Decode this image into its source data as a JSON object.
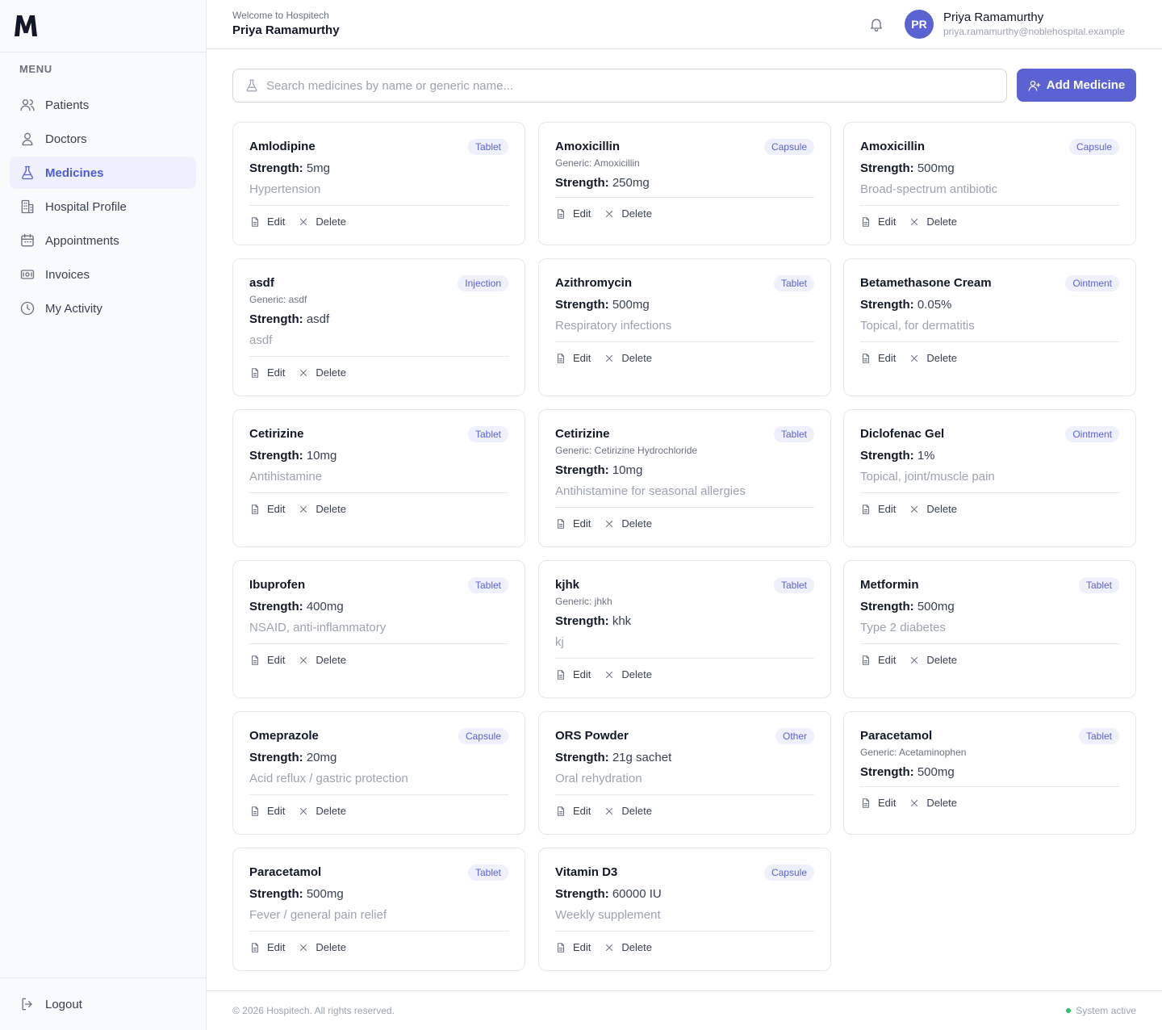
{
  "app": {
    "logo_letter": "M"
  },
  "sidebar": {
    "menu_title": "MENU",
    "items": [
      {
        "label": "Patients",
        "icon": "users-icon",
        "active": false
      },
      {
        "label": "Doctors",
        "icon": "user-icon",
        "active": false
      },
      {
        "label": "Medicines",
        "icon": "flask-icon",
        "active": true
      },
      {
        "label": "Hospital Profile",
        "icon": "building-icon",
        "active": false
      },
      {
        "label": "Appointments",
        "icon": "calendar-icon",
        "active": false
      },
      {
        "label": "Invoices",
        "icon": "banknote-icon",
        "active": false
      },
      {
        "label": "My Activity",
        "icon": "clock-icon",
        "active": false
      }
    ],
    "logout_label": "Logout"
  },
  "header": {
    "welcome": "Welcome to Hospitech",
    "name": "Priya Ramamurthy",
    "avatar_initials": "PR",
    "user_name": "Priya Ramamurthy",
    "user_email": "priya.ramamurthy@noblehospital.example"
  },
  "search": {
    "placeholder": "Search medicines by name or generic name...",
    "value": ""
  },
  "add_button": {
    "label": "Add Medicine"
  },
  "card_labels": {
    "strength": "Strength:",
    "edit": "Edit",
    "delete": "Delete"
  },
  "medicines": [
    {
      "name": "Amlodipine",
      "type": "Tablet",
      "generic": "",
      "strength": "5mg",
      "description": "Hypertension"
    },
    {
      "name": "Amoxicillin",
      "type": "Capsule",
      "generic": "Generic: Amoxicillin",
      "strength": "250mg",
      "description": ""
    },
    {
      "name": "Amoxicillin",
      "type": "Capsule",
      "generic": "",
      "strength": "500mg",
      "description": "Broad-spectrum antibiotic"
    },
    {
      "name": "asdf",
      "type": "Injection",
      "generic": "Generic: asdf",
      "strength": "asdf",
      "description": "asdf"
    },
    {
      "name": "Azithromycin",
      "type": "Tablet",
      "generic": "",
      "strength": "500mg",
      "description": "Respiratory infections"
    },
    {
      "name": "Betamethasone Cream",
      "type": "Ointment",
      "generic": "",
      "strength": "0.05%",
      "description": "Topical, for dermatitis"
    },
    {
      "name": "Cetirizine",
      "type": "Tablet",
      "generic": "",
      "strength": "10mg",
      "description": "Antihistamine"
    },
    {
      "name": "Cetirizine",
      "type": "Tablet",
      "generic": "Generic: Cetirizine Hydrochloride",
      "strength": "10mg",
      "description": "Antihistamine for seasonal allergies"
    },
    {
      "name": "Diclofenac Gel",
      "type": "Ointment",
      "generic": "",
      "strength": "1%",
      "description": "Topical, joint/muscle pain"
    },
    {
      "name": "Ibuprofen",
      "type": "Tablet",
      "generic": "",
      "strength": "400mg",
      "description": "NSAID, anti-inflammatory"
    },
    {
      "name": "kjhk",
      "type": "Tablet",
      "generic": "Generic: jhkh",
      "strength": "khk",
      "description": "kj"
    },
    {
      "name": "Metformin",
      "type": "Tablet",
      "generic": "",
      "strength": "500mg",
      "description": "Type 2 diabetes"
    },
    {
      "name": "Omeprazole",
      "type": "Capsule",
      "generic": "",
      "strength": "20mg",
      "description": "Acid reflux / gastric protection"
    },
    {
      "name": "ORS Powder",
      "type": "Other",
      "generic": "",
      "strength": "21g sachet",
      "description": "Oral rehydration"
    },
    {
      "name": "Paracetamol",
      "type": "Tablet",
      "generic": "Generic: Acetaminophen",
      "strength": "500mg",
      "description": ""
    },
    {
      "name": "Paracetamol",
      "type": "Tablet",
      "generic": "",
      "strength": "500mg",
      "description": "Fever / general pain relief"
    },
    {
      "name": "Vitamin D3",
      "type": "Capsule",
      "generic": "",
      "strength": "60000 IU",
      "description": "Weekly supplement"
    }
  ],
  "footer": {
    "copyright": "© 2026 Hospitech. All rights reserved.",
    "status": "System active"
  },
  "colors": {
    "accent": "#5b63d3",
    "badge_bg": "#eef0fb",
    "status_dot": "#22c55e"
  }
}
